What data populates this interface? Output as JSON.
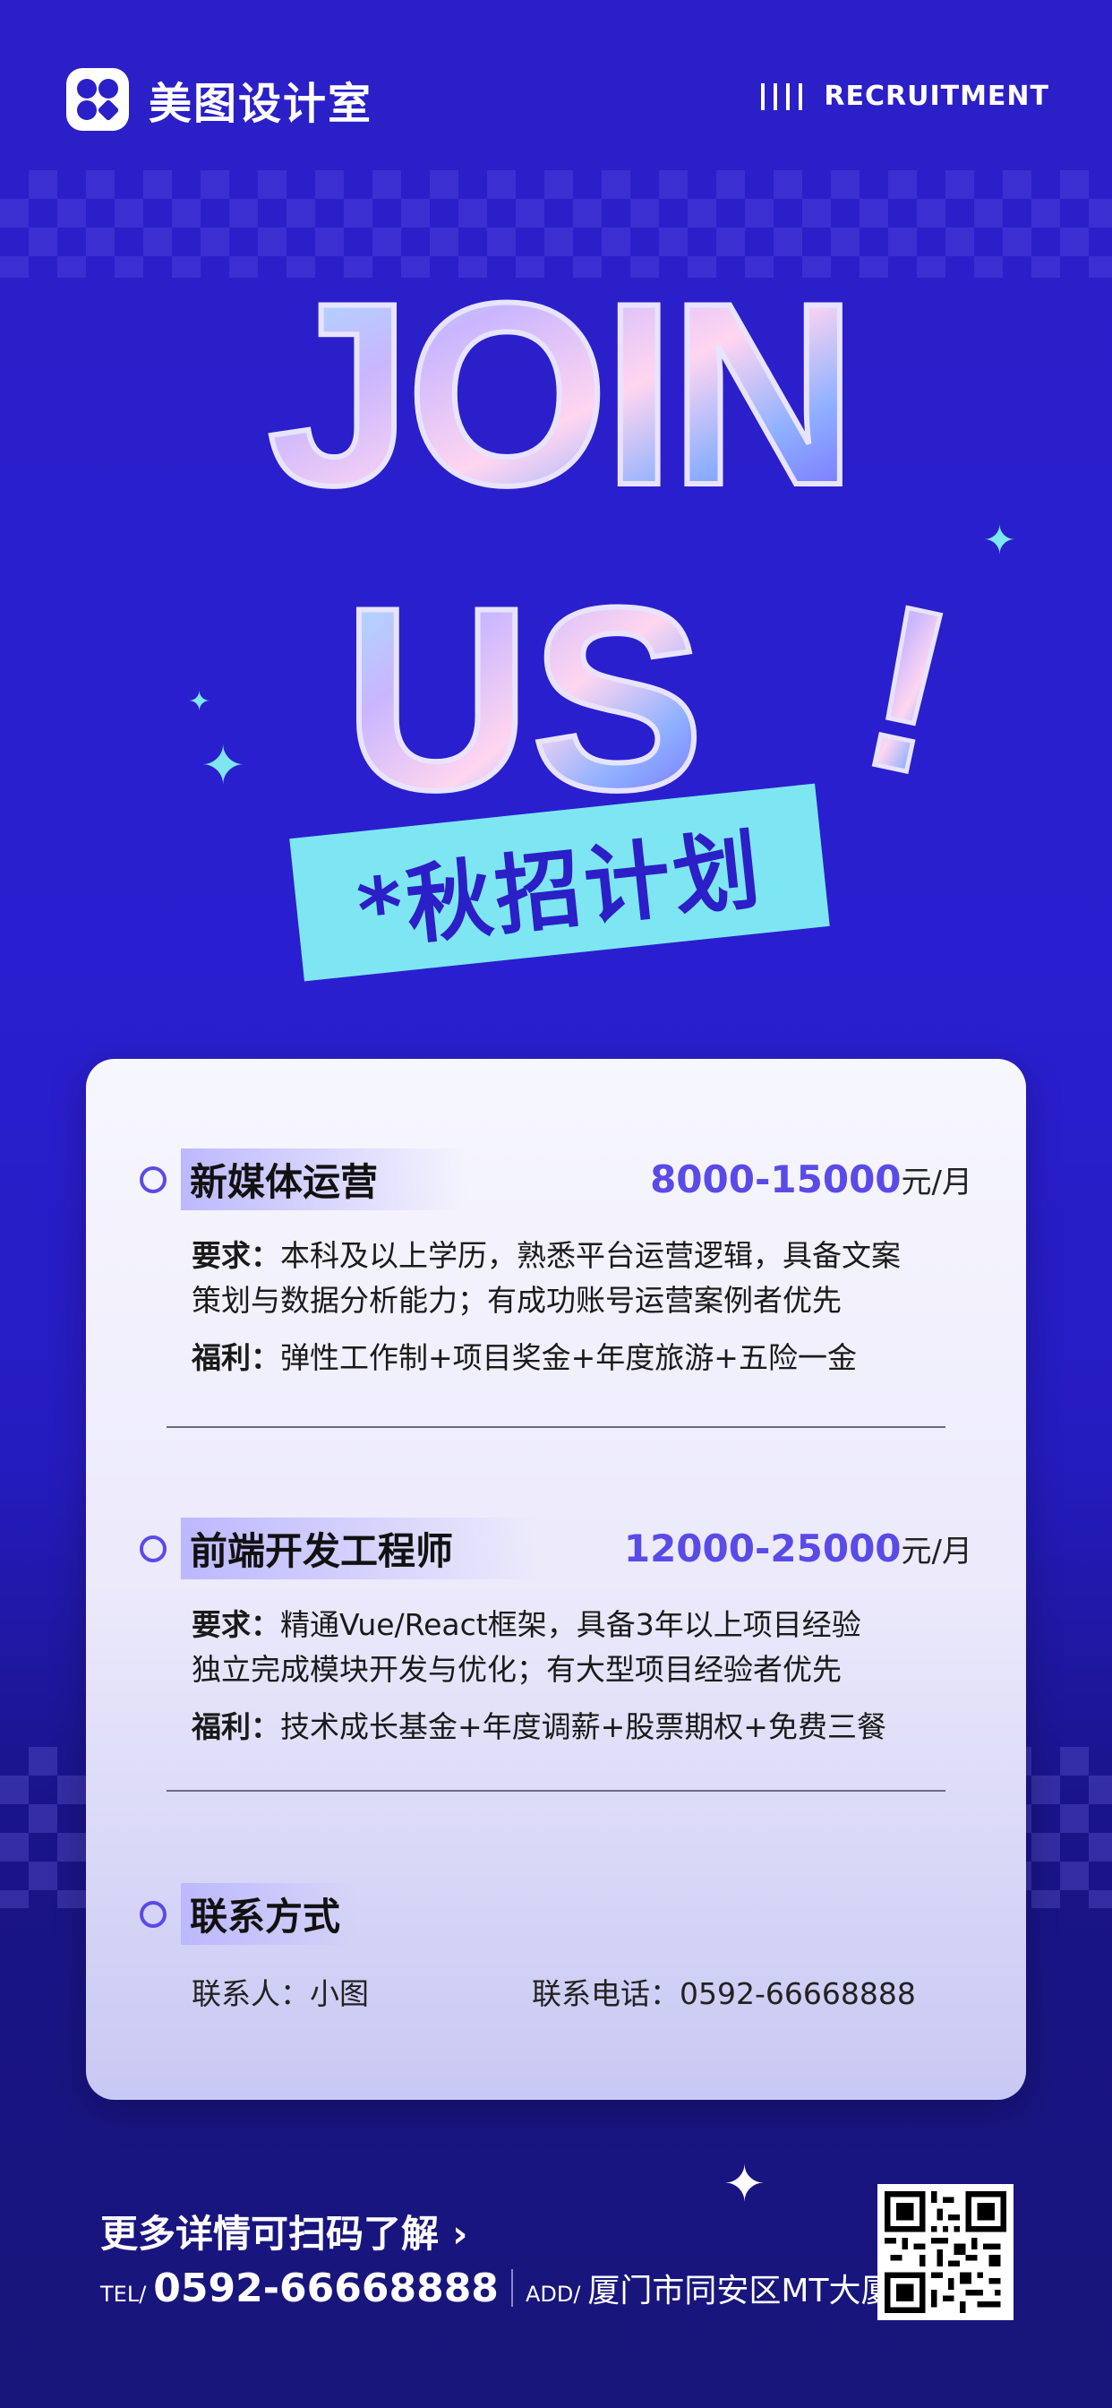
{
  "brand": {
    "name": "美图设计室"
  },
  "header": {
    "recruitment": "RECRUITMENT"
  },
  "hero": {
    "line1": "JOIN",
    "line2": "US",
    "exclaim": "!",
    "campaign": "*秋招计划"
  },
  "jobs": [
    {
      "title": "新媒体运营",
      "salary": "8000-15000",
      "unit": "元/月",
      "req_label": "要求：",
      "req_line1": "本科及以上学历，熟悉平台运营逻辑，具备文案",
      "req_line2": "策划与数据分析能力；有成功账号运营案例者优先",
      "benefit_label": "福利：",
      "benefit": "弹性工作制+项目奖金+年度旅游+五险一金"
    },
    {
      "title": "前端开发工程师",
      "salary": "12000-25000",
      "unit": "元/月",
      "req_label": "要求：",
      "req_line1": "精通Vue/React框架，具备3年以上项目经验",
      "req_line2": "独立完成模块开发与优化；有大型项目经验者优先",
      "benefit_label": "福利：",
      "benefit": "技术成长基金+年度调薪+股票期权+免费三餐"
    }
  ],
  "contact": {
    "title": "联系方式",
    "person": "联系人：小图",
    "phone": "联系电话：0592-66668888"
  },
  "footer": {
    "more": "更多详情可扫码了解",
    "arrow": "›",
    "tel_label": "TEL/",
    "tel": "0592-66668888",
    "add_label": "ADD/",
    "address": "厦门市同安区MT大厦"
  },
  "colors": {
    "bg": "#2b1fc7",
    "accent": "#5a4be8",
    "cyan": "#7ee6f2"
  }
}
